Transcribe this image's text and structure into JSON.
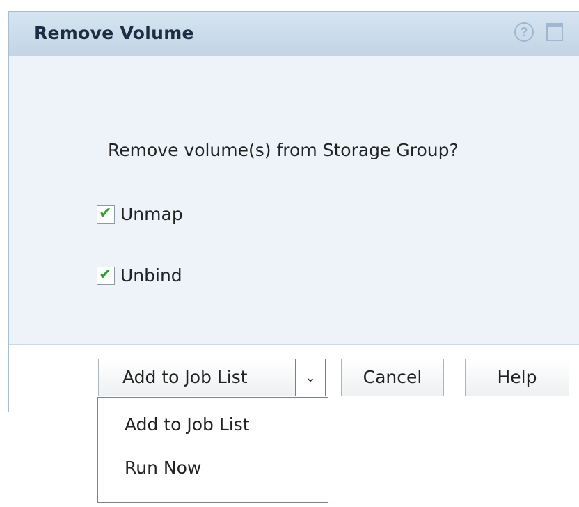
{
  "dialog": {
    "title": "Remove Volume",
    "question": "Remove volume(s) from Storage Group?",
    "options": [
      {
        "label": "Unmap",
        "checked": true
      },
      {
        "label": "Unbind",
        "checked": true
      }
    ]
  },
  "actions": {
    "selected": "Add to Job List",
    "cancel_label": "Cancel",
    "help_label": "Help",
    "dropdown_arrow": "⌄"
  },
  "menu": {
    "items": [
      {
        "label": "Add to Job List"
      },
      {
        "label": "Run Now"
      }
    ]
  },
  "icons": {
    "help_icon": "?",
    "maximize_icon": "maximize-icon",
    "check_mark": "✔"
  },
  "colors": {
    "titlebar": "#c2d5e6",
    "body": "#eef3fa",
    "check": "#2e9e30",
    "accent": "#4c8ac7"
  }
}
